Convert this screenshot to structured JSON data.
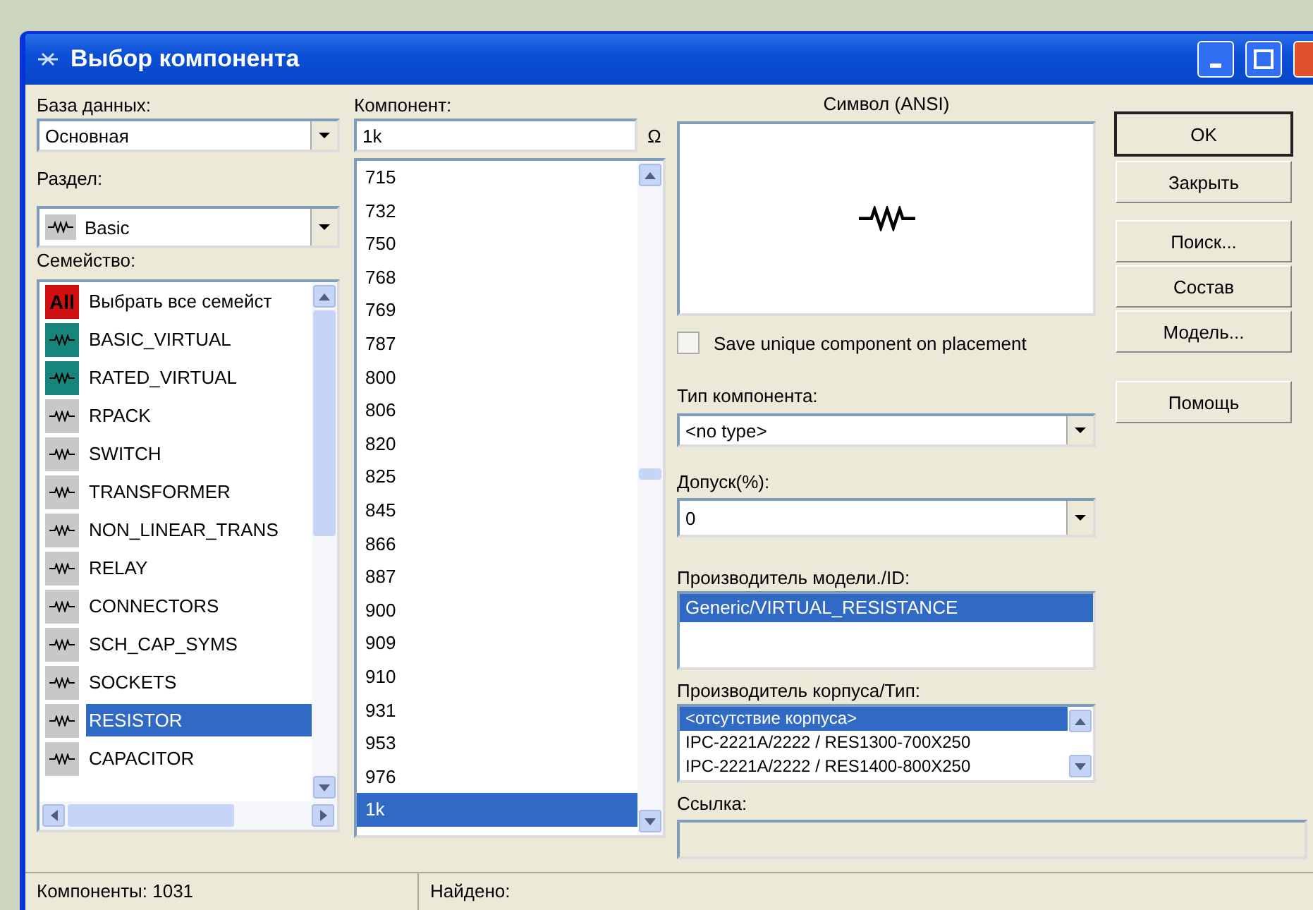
{
  "window": {
    "title": "Выбор компонента"
  },
  "database": {
    "label": "База данных:",
    "value": "Основная"
  },
  "group": {
    "label": "Раздел:",
    "value": "Basic"
  },
  "family": {
    "label": "Семейство:",
    "items": [
      {
        "label": "Выбрать все семейст",
        "badge": "All",
        "color": "#d01010",
        "selected": false
      },
      {
        "label": "BASIC_VIRTUAL",
        "color": "#17857c",
        "selected": false
      },
      {
        "label": "RATED_VIRTUAL",
        "color": "#17857c",
        "selected": false
      },
      {
        "label": "RPACK",
        "color": "#c8c8c8",
        "selected": false
      },
      {
        "label": "SWITCH",
        "color": "#c8c8c8",
        "selected": false
      },
      {
        "label": "TRANSFORMER",
        "color": "#c8c8c8",
        "selected": false
      },
      {
        "label": "NON_LINEAR_TRANS",
        "color": "#c8c8c8",
        "selected": false
      },
      {
        "label": "RELAY",
        "color": "#c8c8c8",
        "selected": false
      },
      {
        "label": "CONNECTORS",
        "color": "#c8c8c8",
        "selected": false
      },
      {
        "label": "SCH_CAP_SYMS",
        "color": "#c8c8c8",
        "selected": false
      },
      {
        "label": "SOCKETS",
        "color": "#c8c8c8",
        "selected": false
      },
      {
        "label": "RESISTOR",
        "color": "#c8c8c8",
        "selected": true
      },
      {
        "label": "CAPACITOR",
        "color": "#c8c8c8",
        "selected": false
      }
    ]
  },
  "component": {
    "label": "Компонент:",
    "value": "1k",
    "unit": "Ω",
    "items": [
      {
        "label": "715",
        "selected": false
      },
      {
        "label": "732",
        "selected": false
      },
      {
        "label": "750",
        "selected": false
      },
      {
        "label": "768",
        "selected": false
      },
      {
        "label": "769",
        "selected": false
      },
      {
        "label": "787",
        "selected": false
      },
      {
        "label": "800",
        "selected": false
      },
      {
        "label": "806",
        "selected": false
      },
      {
        "label": "820",
        "selected": false
      },
      {
        "label": "825",
        "selected": false
      },
      {
        "label": "845",
        "selected": false
      },
      {
        "label": "866",
        "selected": false
      },
      {
        "label": "887",
        "selected": false
      },
      {
        "label": "900",
        "selected": false
      },
      {
        "label": "909",
        "selected": false
      },
      {
        "label": "910",
        "selected": false
      },
      {
        "label": "931",
        "selected": false
      },
      {
        "label": "953",
        "selected": false
      },
      {
        "label": "976",
        "selected": false
      },
      {
        "label": "1k",
        "selected": true
      }
    ]
  },
  "symbol": {
    "title": "Символ (ANSI)"
  },
  "save_unique": {
    "label": "Save unique component on placement",
    "checked": false
  },
  "component_type": {
    "label": "Тип компонента:",
    "value": "<no type>"
  },
  "tolerance": {
    "label": "Допуск(%):",
    "value": "0"
  },
  "model_manufacturer": {
    "label": "Производитель модели./ID:",
    "items": [
      {
        "label": "Generic/VIRTUAL_RESISTANCE",
        "selected": true
      }
    ]
  },
  "footprint_manufacturer": {
    "label": "Производитель корпуса/Тип:",
    "items": [
      {
        "label": "<отсутствие корпуса>",
        "selected": true
      },
      {
        "label": "IPC-2221A/2222 / RES1300-700X250",
        "selected": false
      },
      {
        "label": "IPC-2221A/2222 / RES1400-800X250",
        "selected": false
      }
    ]
  },
  "hyperlink": {
    "label": "Ссылка:"
  },
  "buttons": [
    {
      "label": "OK",
      "default": true
    },
    {
      "label": "Закрыть",
      "default": false
    },
    {
      "label": "Поиск...",
      "default": false
    },
    {
      "label": "Состав",
      "default": false
    },
    {
      "label": "Модель...",
      "default": false
    },
    {
      "label": "Помощь",
      "default": false
    }
  ],
  "status_bar": {
    "components": "Компоненты: 1031",
    "found": "Найдено:"
  }
}
